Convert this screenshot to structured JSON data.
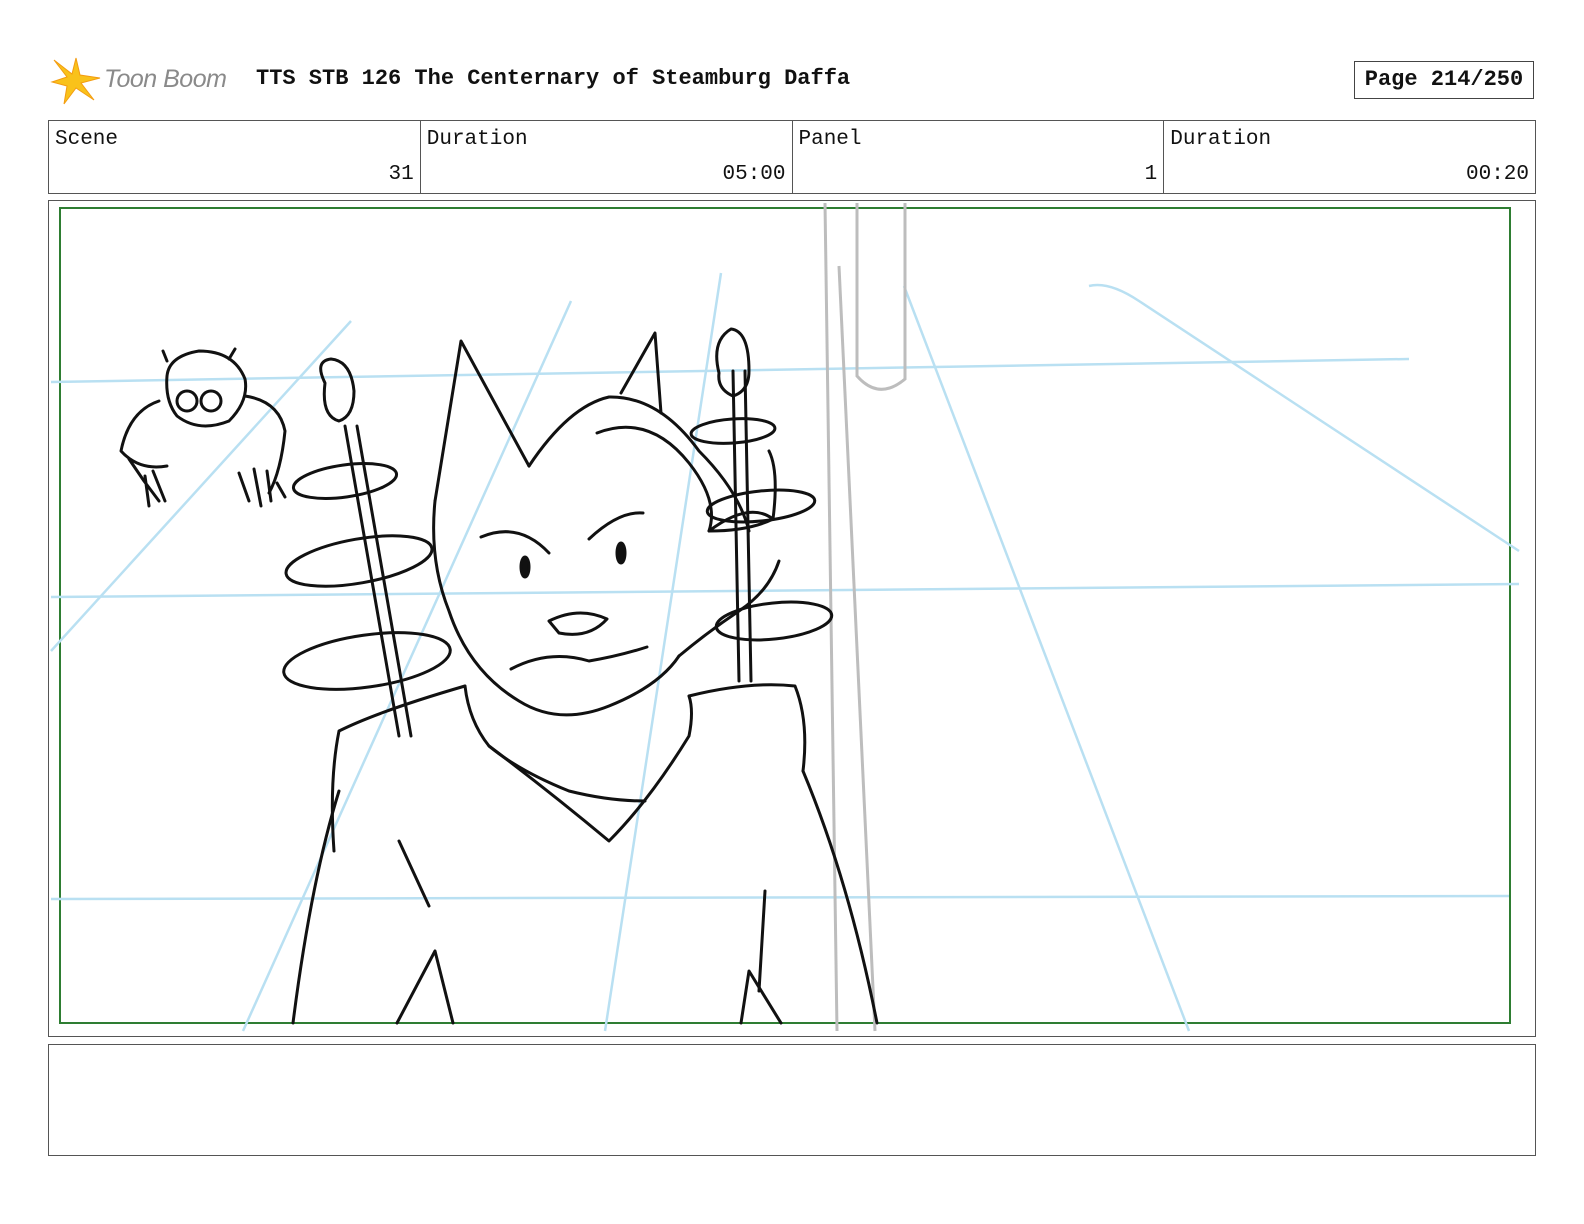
{
  "header": {
    "logo_text": "Toon Boom",
    "title": "TTS STB 126 The Centernary of Steamburg Daffa",
    "page_label": "Page 214/250"
  },
  "info": {
    "scene_label": "Scene",
    "scene_value": "31",
    "scene_duration_label": "Duration",
    "scene_duration_value": "05:00",
    "panel_label": "Panel",
    "panel_value": "1",
    "panel_duration_label": "Duration",
    "panel_duration_value": "00:20"
  },
  "panel": {
    "frame_color": "#2e7d32",
    "guide_color": "#b9e0f2",
    "sketch_color": "#111111"
  },
  "notes": {
    "text": ""
  }
}
